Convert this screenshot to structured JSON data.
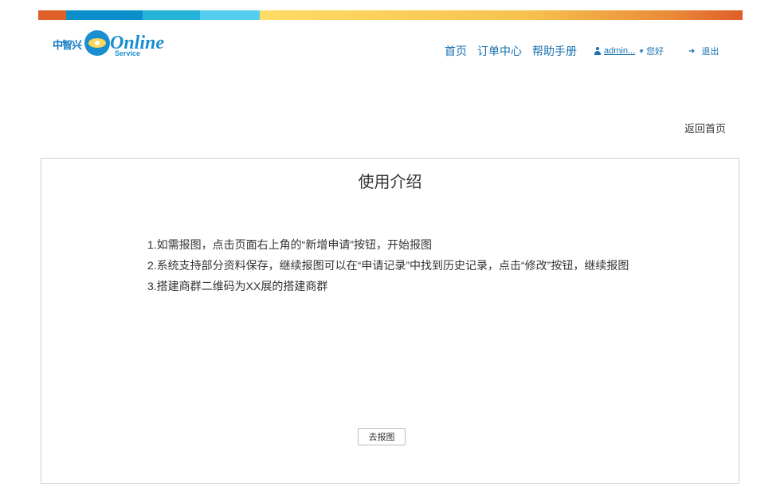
{
  "header": {
    "logo": {
      "cn_text": "中智兴",
      "brand_text": "Online",
      "sub_text": "Service"
    },
    "nav": {
      "home": "首页",
      "orders": "订单中心",
      "help": "帮助手册",
      "user_name": "admin...",
      "user_greeting": "您好",
      "logout": "退出"
    }
  },
  "back_link": "返回首页",
  "panel": {
    "title": "使用介绍",
    "instructions": [
      "1.如需报图，点击页面右上角的“新增申请”按钮，开始报图",
      "2.系统支持部分资料保存，继续报图可以在“申请记录”中找到历史记录，点击“修改”按钮，继续报图",
      "3.搭建商群二维码为XX展的搭建商群"
    ],
    "button": "去报图"
  },
  "colors": {
    "accent_blue": "#1a70b0",
    "bar_orange": "#e0602a",
    "bar_blue": "#0b8fcb",
    "bar_cyan": "#26b3d9",
    "bar_light": "#55cdef",
    "bar_yellow": "#ffdc66"
  }
}
